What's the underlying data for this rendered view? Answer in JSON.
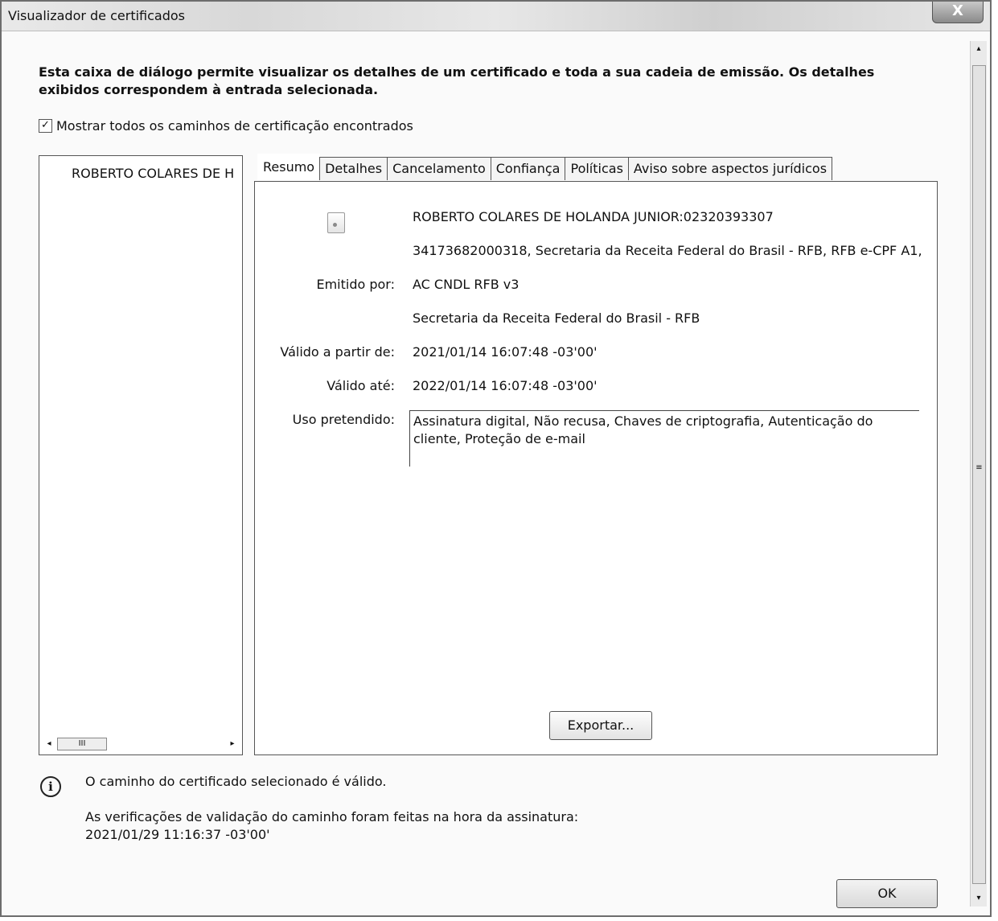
{
  "window": {
    "title": "Visualizador de certificados",
    "close_label": "X"
  },
  "description": "Esta caixa de diálogo permite visualizar os detalhes de um certificado e toda a sua cadeia de emissão. Os detalhes exibidos correspondem à entrada selecionada.",
  "show_all_paths": {
    "checked_mark": "✓",
    "label": "Mostrar todos os caminhos de certificação encontrados"
  },
  "tree": {
    "items": [
      "ROBERTO COLARES DE H"
    ],
    "scroll_left": "◂",
    "scroll_thumb": "III",
    "scroll_right": "▸"
  },
  "tabs": [
    "Resumo",
    "Detalhes",
    "Cancelamento",
    "Confiança",
    "Políticas",
    "Aviso sobre aspectos jurídicos"
  ],
  "summary": {
    "subject_line1": "ROBERTO COLARES DE HOLANDA JUNIOR:02320393307",
    "subject_line2": "34173682000318, Secretaria da Receita Federal do Brasil - RFB, RFB e-CPF A1,",
    "issued_by_label": "Emitido por:",
    "issued_by_line1": "AC CNDL RFB v3",
    "issued_by_line2": "Secretaria da Receita Federal do Brasil - RFB",
    "valid_from_label": "Válido a partir de:",
    "valid_from": "2021/01/14 16:07:48 -03'00'",
    "valid_to_label": "Válido até:",
    "valid_to": "2022/01/14 16:07:48 -03'00'",
    "intended_use_label": "Uso pretendido:",
    "intended_use": "Assinatura digital, Não recusa, Chaves de criptografia, Autenticação do cliente, Proteção de e-mail",
    "export_label": "Exportar..."
  },
  "status": {
    "icon_glyph": "i",
    "line1": "O caminho do certificado selecionado é válido.",
    "line2": "As verificações de validação do caminho foram feitas na hora da assinatura:",
    "line3": "2021/01/29 11:16:37 -03'00'"
  },
  "buttons": {
    "ok": "OK"
  },
  "scrollbar": {
    "up": "▴",
    "grip": "≡",
    "down": "▾"
  }
}
